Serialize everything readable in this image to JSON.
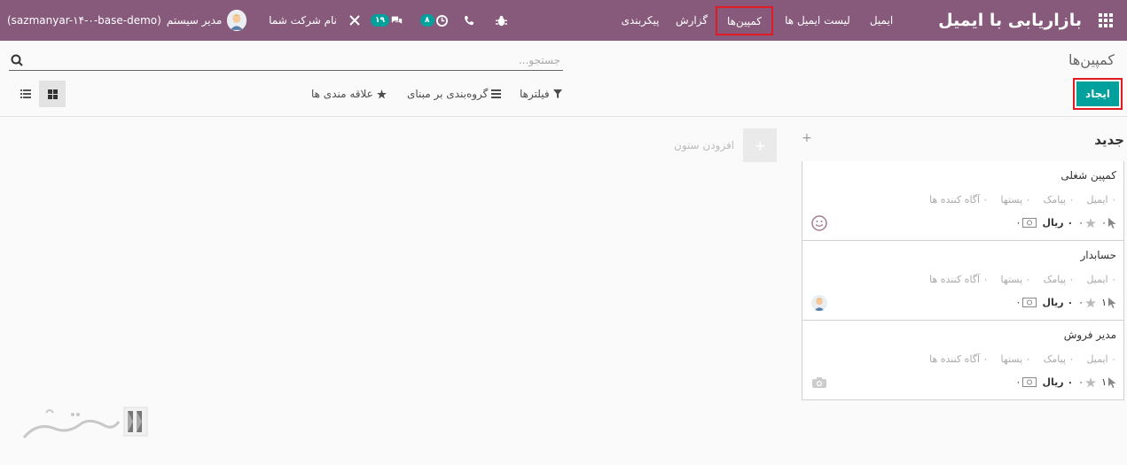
{
  "navbar": {
    "app_title": "بازاریابی با ایمیل",
    "menu": [
      "ایمیل",
      "لیست ایمیل ها",
      "کمپین‌ها",
      "گزارش",
      "پیکربندی"
    ],
    "activity_count": "۸",
    "message_count": "۱۹",
    "company": "نام شرکت شما",
    "user": "مدیر سیستم",
    "db": "(sazmanyar-۱۴-۰-base-demo)"
  },
  "control_panel": {
    "breadcrumb": "کمپین‌ها",
    "search_placeholder": "جستجو...",
    "create_label": "ایجاد",
    "filters_label": "فیلترها",
    "groupby_label": "گروه‌بندی بر مبنای",
    "favorites_label": "علاقه مندی ها"
  },
  "kanban": {
    "column_title": "جدید",
    "add_column_label": "افزودن ستون",
    "cards": [
      {
        "title": "کمپین شغلی",
        "stats": [
          "۰ ایمیل",
          "۰ پیامک",
          "۰ پستها",
          "۰ آگاه کننده ها"
        ],
        "clicks": "۰",
        "stars": "۰",
        "revenue": "۰ ریال",
        "money": "۰",
        "avatar": "smiley-icon"
      },
      {
        "title": "حسابدار",
        "stats": [
          "۰ ایمیل",
          "۰ پیامک",
          "۰ پستها",
          "۰ آگاه کننده ها"
        ],
        "clicks": "۱",
        "stars": "۰",
        "revenue": "۰ ریال",
        "money": "۰",
        "avatar": "user-avatar"
      },
      {
        "title": "مدیر فروش",
        "stats": [
          "۰ ایمیل",
          "۰ پیامک",
          "۰ پستها",
          "۰ آگاه کننده ها"
        ],
        "clicks": "۱",
        "stars": "۰",
        "revenue": "۰ ریال",
        "money": "۰",
        "avatar": "camera-placeholder-icon"
      }
    ]
  },
  "colors": {
    "navbar": "#875a7b",
    "primary": "#00a09d",
    "highlight": "#e01b24"
  }
}
